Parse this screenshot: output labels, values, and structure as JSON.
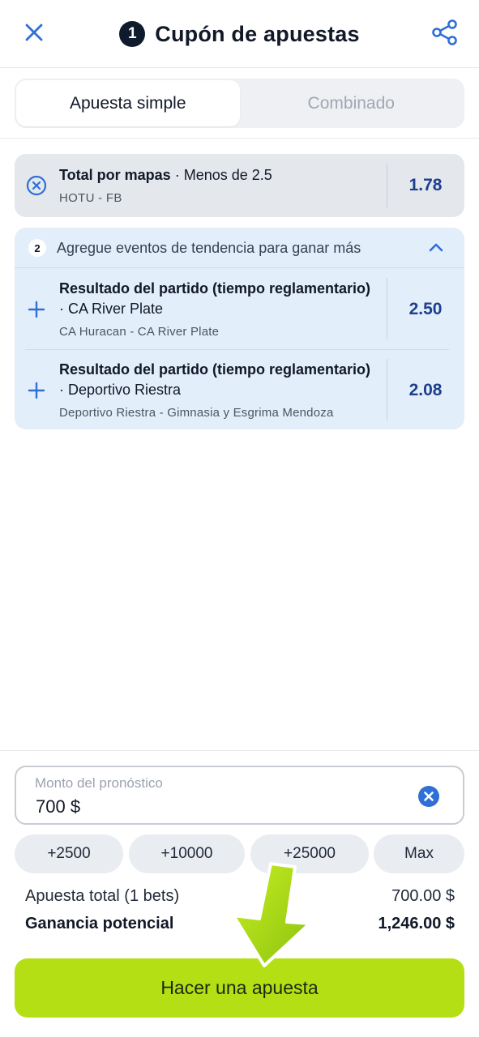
{
  "header": {
    "coupon_count": "1",
    "title": "Cupón de apuestas"
  },
  "tabs": [
    {
      "label": "Apuesta simple",
      "active": true
    },
    {
      "label": "Combinado",
      "active": false
    }
  ],
  "selected_bet": {
    "market": "Total por mapas",
    "selection": " · Menos de 2.5",
    "event": "HOTU - FB",
    "odd": "1.78"
  },
  "trending": {
    "count": "2",
    "title": "Agregue eventos de tendencia para ganar más",
    "items": [
      {
        "market": "Resultado del partido (tiempo reglamentario)",
        "selection": "· CA River Plate",
        "event": "CA Huracan - CA River Plate",
        "odd": "2.50"
      },
      {
        "market": "Resultado del partido (tiempo reglamentario)",
        "selection": "· Deportivo Riestra",
        "event": "Deportivo Riestra - Gimnasia y Esgrima Mendoza",
        "odd": "2.08"
      }
    ]
  },
  "stake": {
    "label": "Monto del pronóstico",
    "value": "700 $"
  },
  "quick_amounts": [
    "+2500",
    "+10000",
    "+25000",
    "Max"
  ],
  "summary": {
    "total_label": "Apuesta total (1 bets)",
    "total_value": "700.00 $",
    "potential_label": "Ganancia potencial",
    "potential_value": "1,246.00 $"
  },
  "place_bet_label": "Hacer una apuesta",
  "colors": {
    "accent": "#2f6fd6",
    "odds": "#1d3f8c",
    "cta": "#b3df14",
    "trend_bg": "#e3eefb"
  },
  "icons": [
    "close-icon",
    "share-icon",
    "remove-circle-icon",
    "chevron-up-icon",
    "plus-icon",
    "clear-circle-icon",
    "pointer-arrow-icon"
  ]
}
